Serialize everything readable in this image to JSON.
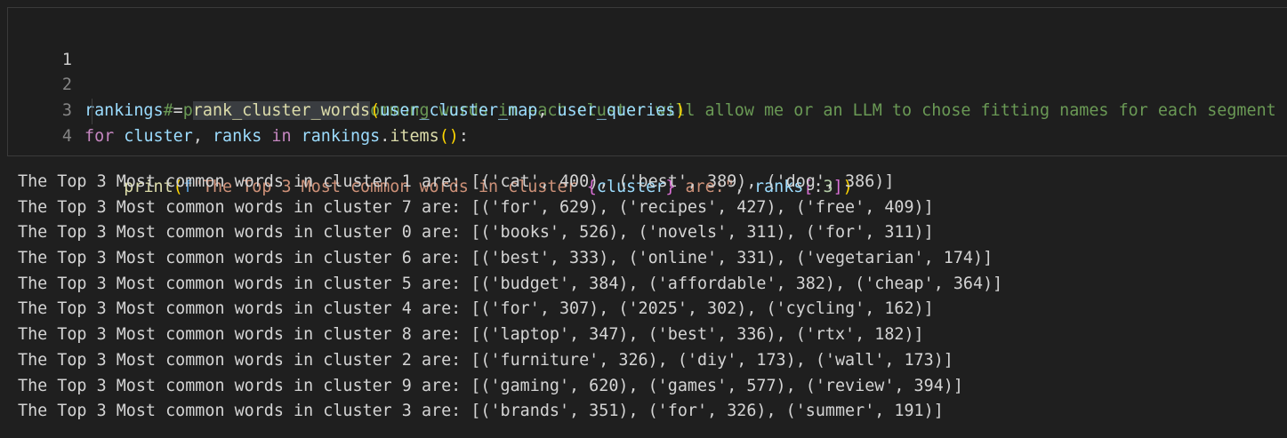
{
  "code_cell": {
    "line_numbers": [
      "1",
      "2",
      "3",
      "4"
    ],
    "line1": {
      "comment": "# printing the most commong words in each cluster will allow me or an LLM to chose fitting names for each segment"
    },
    "line2": {
      "var": "rankings",
      "eq": " = ",
      "fn": "rank_cluster_words",
      "open": "(",
      "arg1": "user_cluster_map",
      "comma": ", ",
      "arg2": "user_queries",
      "close": ")"
    },
    "line3": {
      "kw_for": "for",
      "sp1": " ",
      "var1": "cluster",
      "comma": ", ",
      "var2": "ranks",
      "sp2": " ",
      "kw_in": "in",
      "sp3": " ",
      "obj": "rankings",
      "dot": ".",
      "method": "items",
      "parens": "()",
      "colon": ":"
    },
    "line4": {
      "indent": "    ",
      "fn": "print",
      "open": "(",
      "fprefix": "f",
      "str1": "\"The Top 3 Most common words in cluster ",
      "lbrace": "{",
      "interp": "cluster",
      "rbrace": "}",
      "str2": " are:\"",
      "comma": ", ",
      "var": "ranks",
      "lbracket": "[",
      "slice_colon": ":",
      "num": "3",
      "rbracket": "]",
      "close": ")"
    }
  },
  "output": [
    "The Top 3 Most common words in cluster 1 are: [('cat', 400), ('best', 389), ('dog', 386)]",
    "The Top 3 Most common words in cluster 7 are: [('for', 629), ('recipes', 427), ('free', 409)]",
    "The Top 3 Most common words in cluster 0 are: [('books', 526), ('novels', 311), ('for', 311)]",
    "The Top 3 Most common words in cluster 6 are: [('best', 333), ('online', 331), ('vegetarian', 174)]",
    "The Top 3 Most common words in cluster 5 are: [('budget', 384), ('affordable', 382), ('cheap', 364)]",
    "The Top 3 Most common words in cluster 4 are: [('for', 307), ('2025', 302), ('cycling', 162)]",
    "The Top 3 Most common words in cluster 8 are: [('laptop', 347), ('best', 336), ('rtx', 182)]",
    "The Top 3 Most common words in cluster 2 are: [('furniture', 326), ('diy', 173), ('wall', 173)]",
    "The Top 3 Most common words in cluster 9 are: [('gaming', 620), ('games', 577), ('review', 394)]",
    "The Top 3 Most common words in cluster 3 are: [('brands', 351), ('for', 326), ('summer', 191)]"
  ],
  "colors": {
    "background": "#1f1f1f",
    "comment": "#6a9955",
    "variable": "#9cdcfe",
    "function": "#dcdcaa",
    "keyword": "#c586c0",
    "string": "#ce9178",
    "number": "#b5cea8"
  }
}
